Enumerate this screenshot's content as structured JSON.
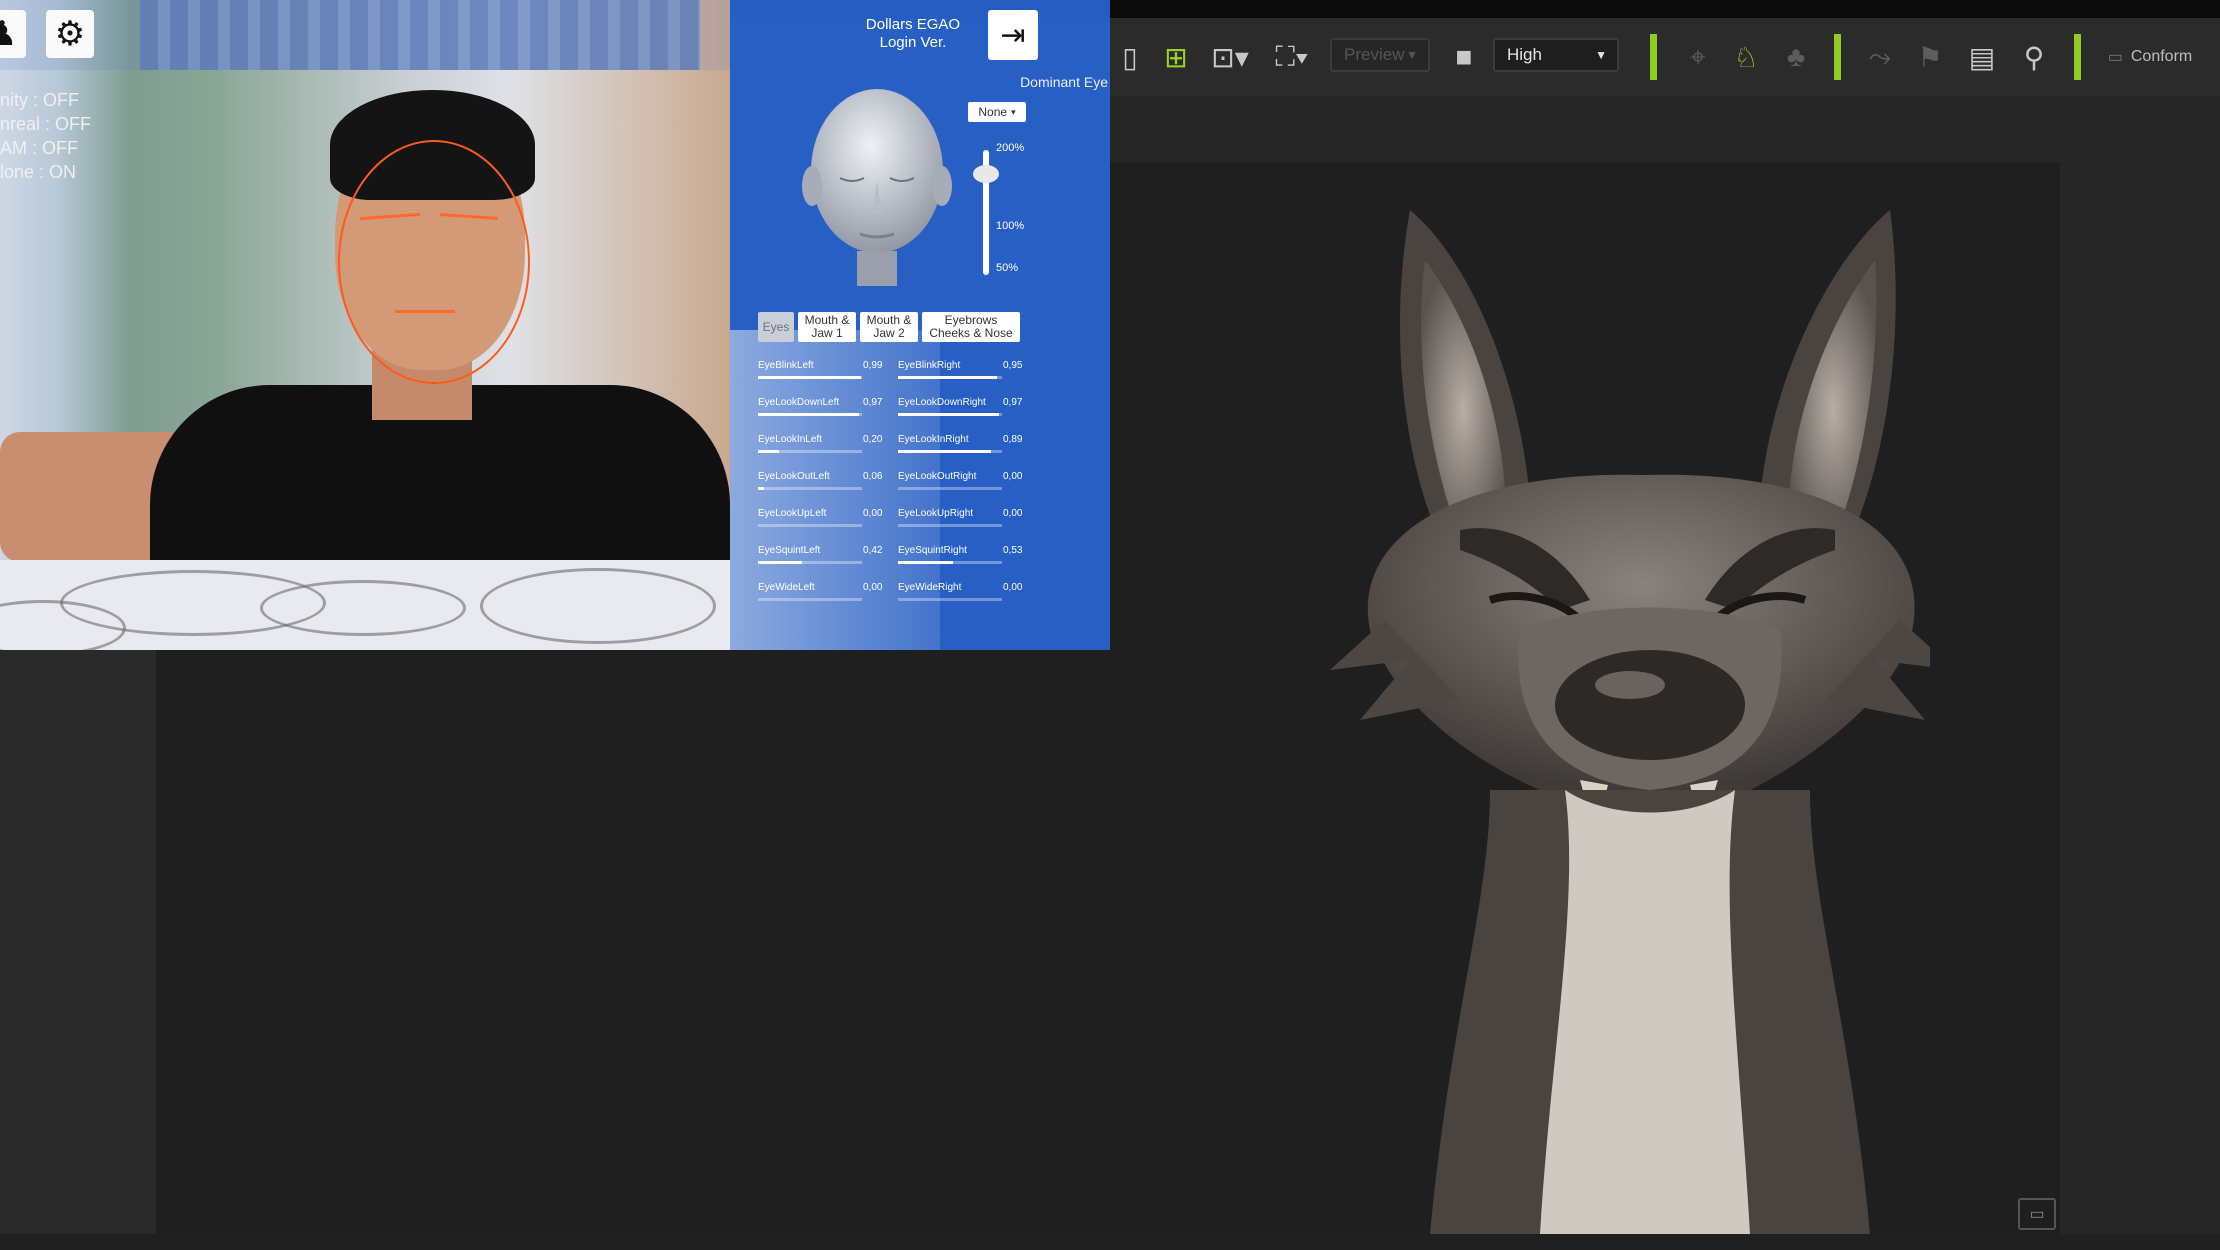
{
  "toolbar": {
    "preview_label": "Preview",
    "quality_value": "High",
    "conform_label": "Conform"
  },
  "overlay": {
    "app_title_line1": "Dollars EGAO",
    "app_title_line2": "Login Ver.",
    "status_lines": [
      "nity   : OFF",
      "nreal  : OFF",
      "AM     : OFF",
      "lone   : ON"
    ],
    "dominant_eye": {
      "label": "Dominant Eye",
      "value": "None"
    },
    "scale_slider": {
      "labels": [
        "200%",
        "100%",
        "50%"
      ]
    },
    "tabs": [
      {
        "label": "Eyes",
        "active": true
      },
      {
        "label": "Mouth & Jaw 1",
        "active": false
      },
      {
        "label": "Mouth & Jaw 2",
        "active": false
      },
      {
        "label": "Eyebrows Cheeks & Nose",
        "active": false
      }
    ],
    "blendshapes": [
      {
        "name": "EyeBlinkLeft",
        "value": "0,99",
        "level": 0.99
      },
      {
        "name": "EyeBlinkRight",
        "value": "0,95",
        "level": 0.95
      },
      {
        "name": "EyeLookDownLeft",
        "value": "0,97",
        "level": 0.97
      },
      {
        "name": "EyeLookDownRight",
        "value": "0,97",
        "level": 0.97
      },
      {
        "name": "EyeLookInLeft",
        "value": "0,20",
        "level": 0.2
      },
      {
        "name": "EyeLookInRight",
        "value": "0,89",
        "level": 0.89
      },
      {
        "name": "EyeLookOutLeft",
        "value": "0,06",
        "level": 0.06
      },
      {
        "name": "EyeLookOutRight",
        "value": "0,00",
        "level": 0.0
      },
      {
        "name": "EyeLookUpLeft",
        "value": "0,00",
        "level": 0.0
      },
      {
        "name": "EyeLookUpRight",
        "value": "0,00",
        "level": 0.0
      },
      {
        "name": "EyeSquintLeft",
        "value": "0,42",
        "level": 0.42
      },
      {
        "name": "EyeSquintRight",
        "value": "0,53",
        "level": 0.53
      },
      {
        "name": "EyeWideLeft",
        "value": "0,00",
        "level": 0.0
      },
      {
        "name": "EyeWideRight",
        "value": "0,00",
        "level": 0.0
      }
    ]
  }
}
